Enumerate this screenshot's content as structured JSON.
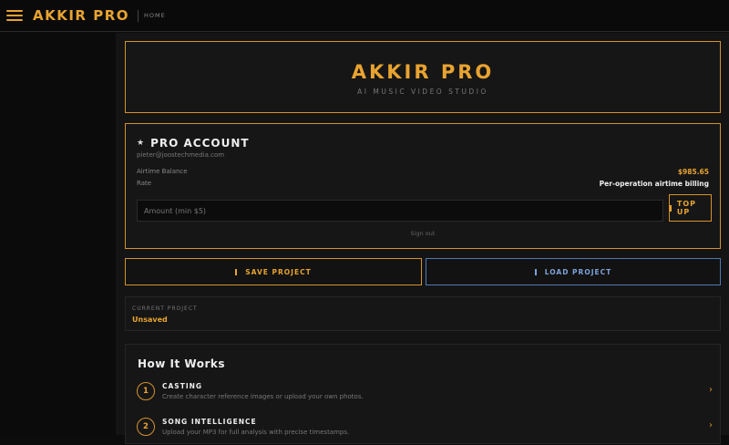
{
  "topbar": {
    "brand": "AKKIR PRO",
    "nav_home": "HOME"
  },
  "hero": {
    "title": "AKKIR PRO",
    "subtitle": "AI MUSIC VIDEO STUDIO"
  },
  "account": {
    "star": "★",
    "title": "PRO ACCOUNT",
    "email": "pieter@joostechmedia.com",
    "balance_label": "Airtime Balance",
    "balance_value": "$985.65",
    "rate_label": "Rate",
    "rate_value": "Per-operation airtime billing",
    "amount_placeholder": "Amount (min $5)",
    "amount_value": "",
    "topup_label": "TOP UP",
    "signout_label": "Sign out"
  },
  "project_actions": {
    "save_label": "SAVE PROJECT",
    "load_label": "LOAD PROJECT"
  },
  "current_project": {
    "label": "CURRENT PROJECT",
    "value": "Unsaved"
  },
  "how_it_works": {
    "title": "How It Works",
    "steps": [
      {
        "num": "1",
        "title": "CASTING",
        "desc": "Create character reference images or upload your own photos."
      },
      {
        "num": "2",
        "title": "SONG INTELLIGENCE",
        "desc": "Upload your MP3 for full analysis with precise timestamps."
      }
    ],
    "chevron": "›"
  },
  "colors": {
    "accent": "#e8a330",
    "load_accent": "#4f78b4",
    "background": "#141414"
  }
}
